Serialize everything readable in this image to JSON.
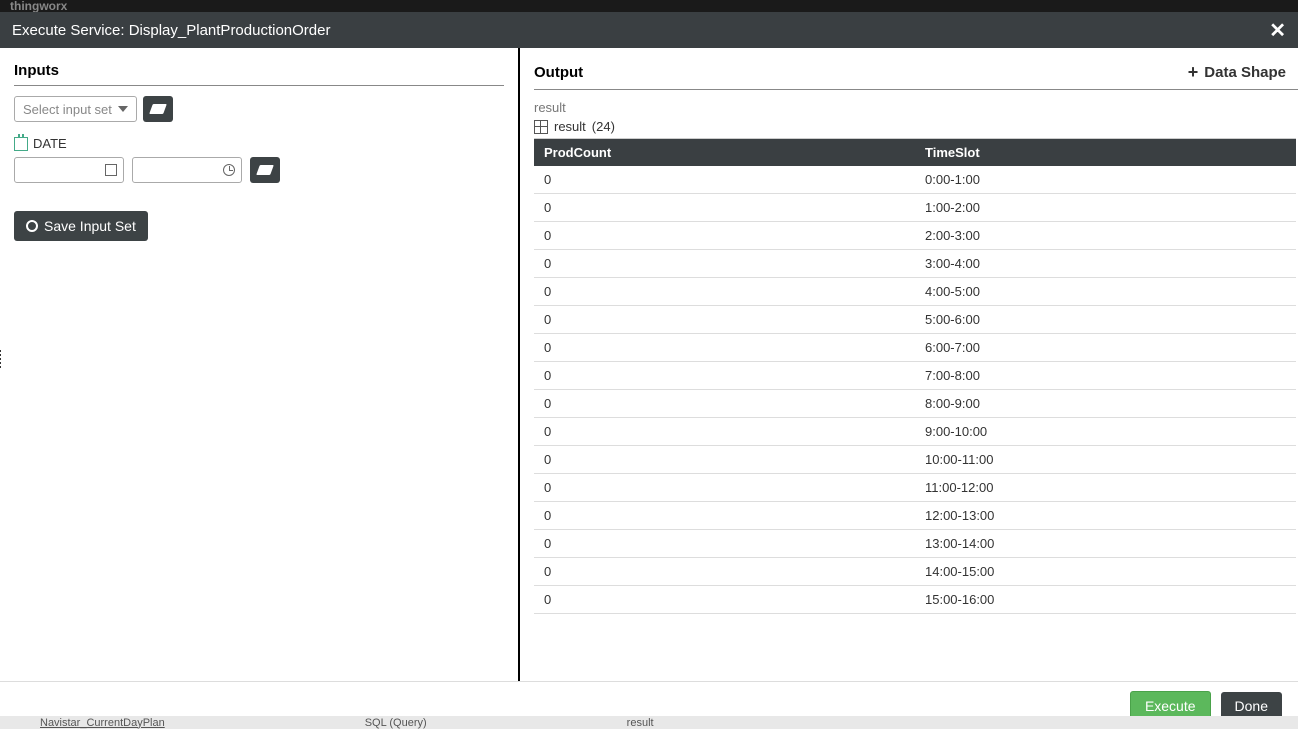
{
  "header": {
    "title": "Execute Service: Display_PlantProductionOrder"
  },
  "inputs": {
    "title": "Inputs",
    "select_placeholder": "Select input set",
    "date_label": "DATE",
    "save_label": "Save Input Set"
  },
  "output": {
    "title": "Output",
    "datashape_label": "Data Shape",
    "result_label": "result",
    "result_name": "result",
    "result_count": "(24)",
    "columns": [
      "ProdCount",
      "TimeSlot"
    ],
    "rows": [
      {
        "ProdCount": "0",
        "TimeSlot": "0:00-1:00"
      },
      {
        "ProdCount": "0",
        "TimeSlot": "1:00-2:00"
      },
      {
        "ProdCount": "0",
        "TimeSlot": "2:00-3:00"
      },
      {
        "ProdCount": "0",
        "TimeSlot": "3:00-4:00"
      },
      {
        "ProdCount": "0",
        "TimeSlot": "4:00-5:00"
      },
      {
        "ProdCount": "0",
        "TimeSlot": "5:00-6:00"
      },
      {
        "ProdCount": "0",
        "TimeSlot": "6:00-7:00"
      },
      {
        "ProdCount": "0",
        "TimeSlot": "7:00-8:00"
      },
      {
        "ProdCount": "0",
        "TimeSlot": "8:00-9:00"
      },
      {
        "ProdCount": "0",
        "TimeSlot": "9:00-10:00"
      },
      {
        "ProdCount": "0",
        "TimeSlot": "10:00-11:00"
      },
      {
        "ProdCount": "0",
        "TimeSlot": "11:00-12:00"
      },
      {
        "ProdCount": "0",
        "TimeSlot": "12:00-13:00"
      },
      {
        "ProdCount": "0",
        "TimeSlot": "13:00-14:00"
      },
      {
        "ProdCount": "0",
        "TimeSlot": "14:00-15:00"
      },
      {
        "ProdCount": "0",
        "TimeSlot": "15:00-16:00"
      }
    ]
  },
  "footer": {
    "execute_label": "Execute",
    "done_label": "Done"
  },
  "background": {
    "item1": "Navistar_CurrentDayPlan",
    "item2": "SQL (Query)",
    "item3": "result"
  }
}
